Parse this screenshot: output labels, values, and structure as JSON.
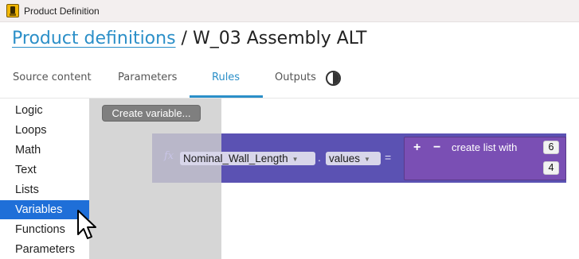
{
  "window": {
    "title": "Product Definition"
  },
  "heading": {
    "link": "Product definitions",
    "separator": "/",
    "name": "W_03 Assembly ALT"
  },
  "tabs": [
    {
      "label": "Source content"
    },
    {
      "label": "Parameters"
    },
    {
      "label": "Rules"
    },
    {
      "label": "Outputs"
    }
  ],
  "active_tab": "Rules",
  "categories": [
    {
      "label": "Logic"
    },
    {
      "label": "Loops"
    },
    {
      "label": "Math"
    },
    {
      "label": "Text"
    },
    {
      "label": "Lists"
    },
    {
      "label": "Variables"
    },
    {
      "label": "Functions"
    },
    {
      "label": "Parameters"
    }
  ],
  "selected_category": "Variables",
  "flyout": {
    "create_variable": "Create variable..."
  },
  "block": {
    "fx": "fx",
    "variable": "Nominal_Wall_Length",
    "dot": ".",
    "property": "values",
    "equals": "=",
    "list_label": "create list with",
    "plus": "+",
    "minus": "−",
    "items": [
      "6",
      "4"
    ]
  },
  "colors": {
    "accent": "#2b8fc8",
    "selected_category": "#1f6fd8",
    "variable_block": "#5b52b3",
    "list_block": "#7a4fb4",
    "flyout": "#d6d6d6"
  },
  "icons": [
    "app-icon",
    "contrast-icon",
    "mouse-pointer-icon"
  ]
}
